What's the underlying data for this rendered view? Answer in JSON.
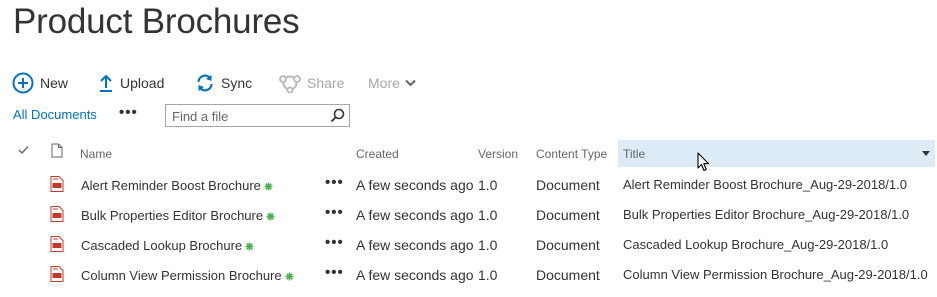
{
  "page": {
    "title": "Product Brochures"
  },
  "commands": {
    "new": "New",
    "upload": "Upload",
    "sync": "Sync",
    "share": "Share",
    "more": "More"
  },
  "view": {
    "name": "All Documents",
    "ellipsis": "•••",
    "search_placeholder": "Find a file"
  },
  "columns": {
    "name": "Name",
    "created": "Created",
    "version": "Version",
    "content_type": "Content Type",
    "title": "Title"
  },
  "rows": [
    {
      "name": "Alert Reminder Boost Brochure",
      "created": "A few seconds ago",
      "version": "1.0",
      "content_type": "Document",
      "title": "Alert Reminder Boost Brochure_Aug-29-2018/1.0"
    },
    {
      "name": "Bulk Properties Editor Brochure",
      "created": "A few seconds ago",
      "version": "1.0",
      "content_type": "Document",
      "title": "Bulk Properties Editor Brochure_Aug-29-2018/1.0"
    },
    {
      "name": "Cascaded Lookup Brochure",
      "created": "A few seconds ago",
      "version": "1.0",
      "content_type": "Document",
      "title": "Cascaded Lookup Brochure_Aug-29-2018/1.0"
    },
    {
      "name": "Column View Permission Brochure",
      "created": "A few seconds ago",
      "version": "1.0",
      "content_type": "Document",
      "title": "Column View Permission Brochure_Aug-29-2018/1.0"
    }
  ],
  "row_menu": "•••",
  "colors": {
    "accent": "#0072c6",
    "new_badge": "#4caf50",
    "pdf_red": "#c0392b",
    "sorted_column_bg": "#ddebf7",
    "disabled": "#a6a6a6"
  },
  "icons": {
    "new": "plus-circle-icon",
    "upload": "upload-arrow-icon",
    "sync": "sync-icon",
    "share": "share-icon",
    "more": "chevron-down-icon",
    "search": "search-icon",
    "file": "pdf-file-icon",
    "new_badge": "new-item-icon"
  }
}
